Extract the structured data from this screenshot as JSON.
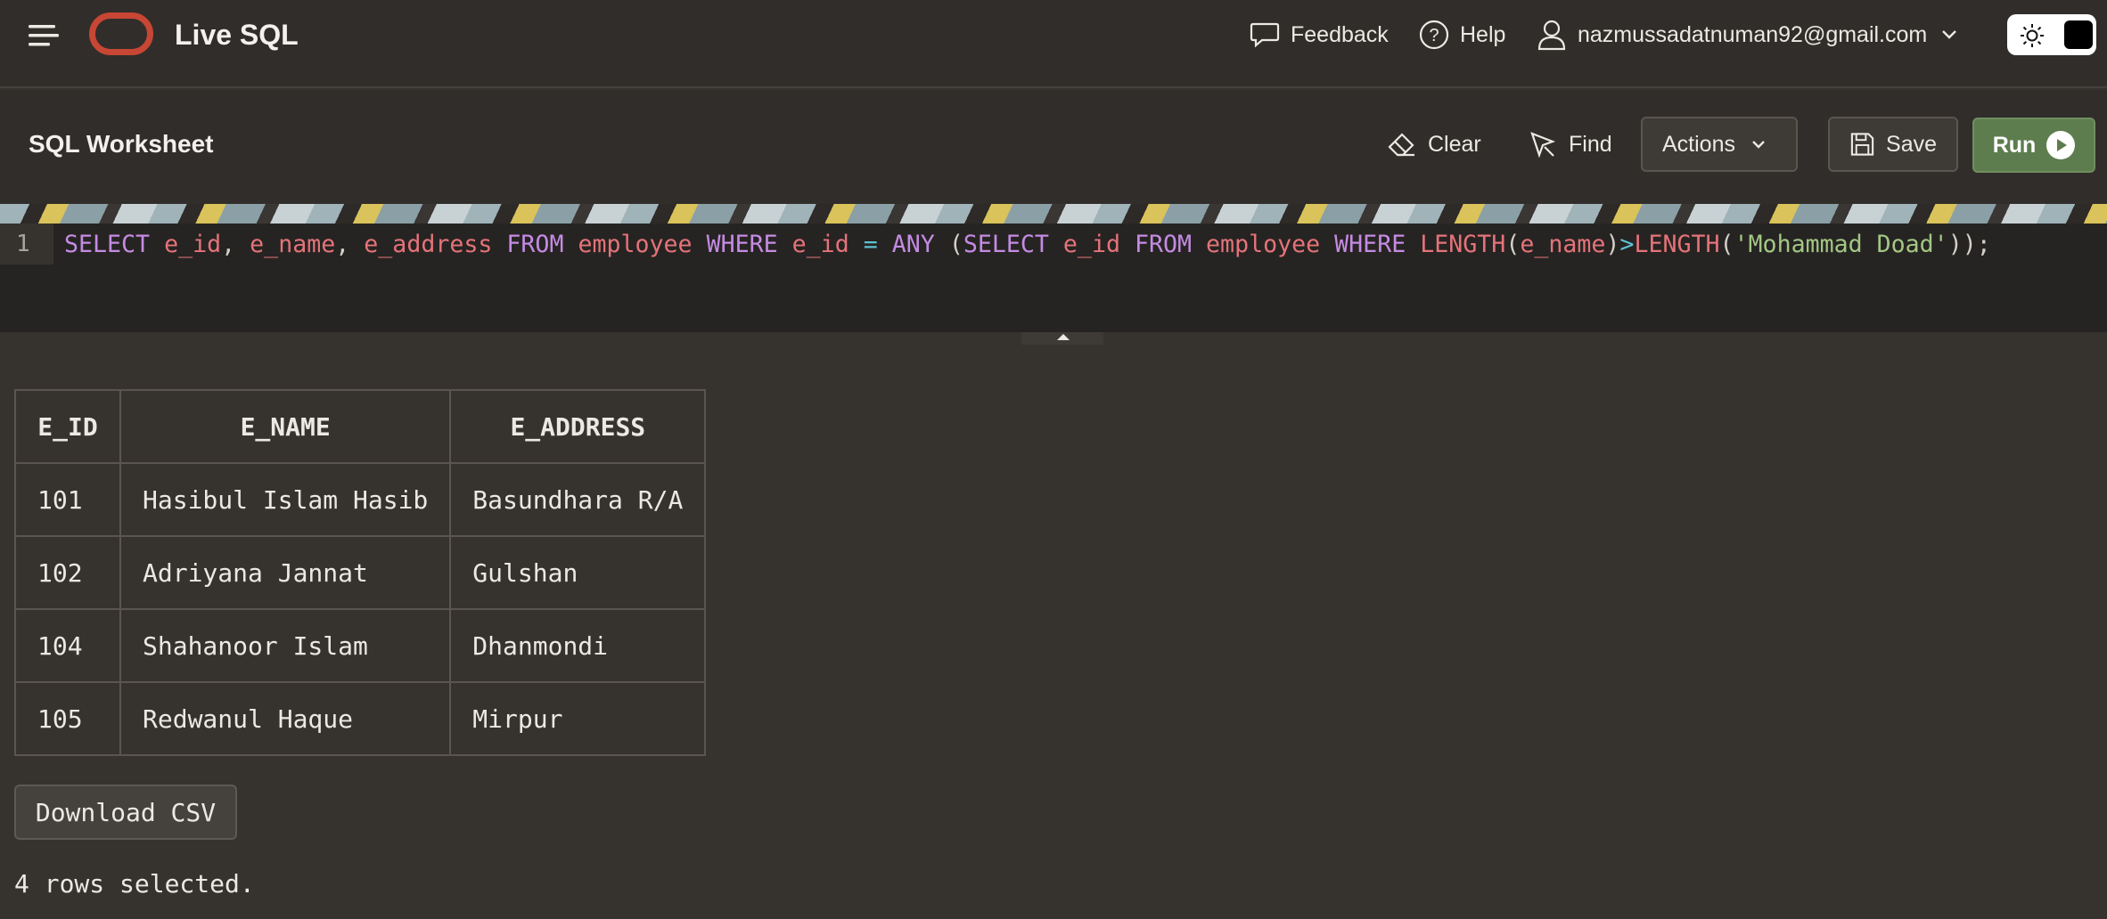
{
  "topbar": {
    "app_title": "Live SQL",
    "feedback": "Feedback",
    "help": "Help",
    "user_email": "nazmussadatnuman92@gmail.com"
  },
  "worksheet": {
    "title": "SQL Worksheet",
    "clear": "Clear",
    "find": "Find",
    "actions": "Actions",
    "save": "Save",
    "run": "Run"
  },
  "editor": {
    "line_number": "1",
    "code": "SELECT e_id, e_name, e_address FROM employee WHERE e_id = ANY (SELECT e_id FROM employee WHERE LENGTH(e_name)>LENGTH('Mohammad Doad'));"
  },
  "results": {
    "columns": [
      "E_ID",
      "E_NAME",
      "E_ADDRESS"
    ],
    "rows": [
      [
        "101",
        "Hasibul Islam Hasib",
        "Basundhara R/A"
      ],
      [
        "102",
        "Adriyana Jannat",
        "Gulshan"
      ],
      [
        "104",
        "Shahanoor Islam",
        "Dhanmondi"
      ],
      [
        "105",
        "Redwanul Haque",
        "Mirpur"
      ]
    ],
    "download": "Download CSV",
    "status": "4 rows selected."
  },
  "colors": {
    "brand_logo": "#c74634",
    "run_button": "#5e7d4e",
    "keyword": "#c58be3",
    "identifier": "#e5737a",
    "string": "#a3c784"
  }
}
